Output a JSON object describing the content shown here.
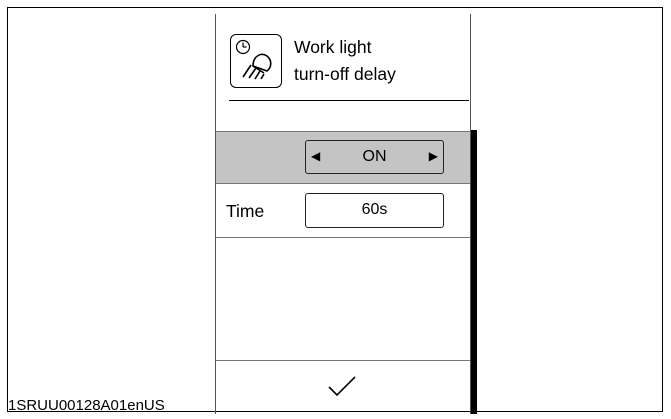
{
  "reference_code": "1SRUU00128A01enUS",
  "header": {
    "icon": "work-light-timer-icon",
    "title_line1": "Work light",
    "title_line2": "turn-off delay"
  },
  "mode_selector": {
    "value": "ON",
    "left_arrow": "◀",
    "right_arrow": "▶"
  },
  "time_setting": {
    "label": "Time",
    "value": "60s"
  },
  "footer": {
    "confirm_icon": "checkmark-icon"
  },
  "colors": {
    "selected_row": "#c4c4c4",
    "scrollbar": "#000000"
  }
}
